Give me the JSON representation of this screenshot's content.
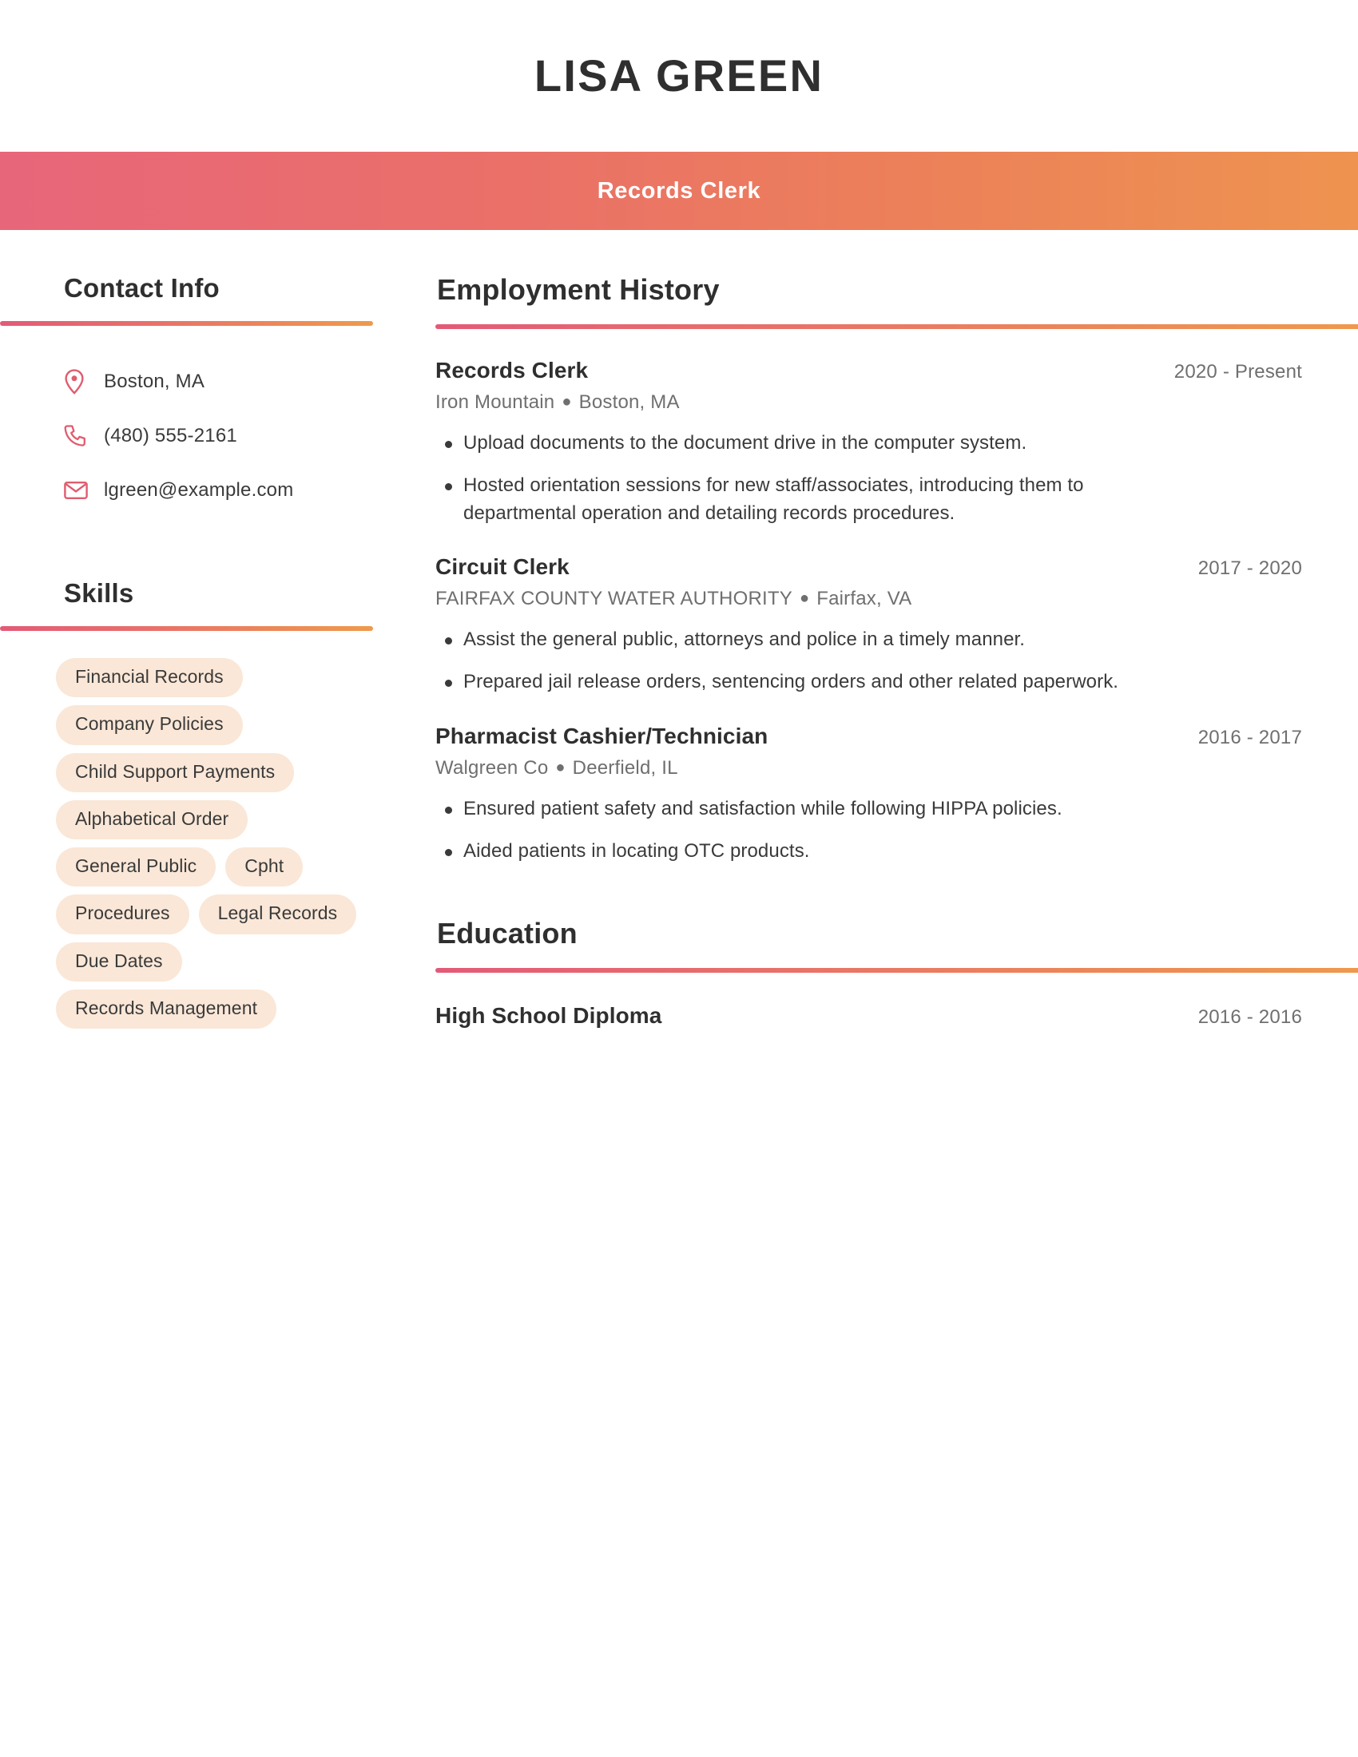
{
  "header": {
    "name": "LISA GREEN",
    "role": "Records Clerk",
    "gradient_start": "#e8667a",
    "gradient_end": "#ee9350"
  },
  "sidebar": {
    "contact": {
      "heading": "Contact Info",
      "items": [
        {
          "icon": "location-pin-icon",
          "value": "Boston, MA"
        },
        {
          "icon": "phone-icon",
          "value": "(480) 555-2161"
        },
        {
          "icon": "envelope-icon",
          "value": "lgreen@example.com"
        }
      ]
    },
    "skills": {
      "heading": "Skills",
      "chip_bg": "#fae7d7",
      "items": [
        "Financial Records",
        "Company Policies",
        "Child Support Payments",
        "Alphabetical Order",
        "General Public",
        "Cpht",
        "Procedures",
        "Legal Records",
        "Due Dates",
        "Records Management"
      ]
    }
  },
  "main": {
    "employment": {
      "heading": "Employment History",
      "jobs": [
        {
          "title": "Records Clerk",
          "dates": "2020 - Present",
          "company": "Iron Mountain",
          "location": "Boston, MA",
          "bullets": [
            "Upload documents to the document drive in the computer system.",
            "Hosted orientation sessions for new staff/associates, introducing them to departmental operation and detailing records procedures."
          ]
        },
        {
          "title": "Circuit Clerk",
          "dates": "2017 - 2020",
          "company": "FAIRFAX COUNTY WATER AUTHORITY",
          "location": "Fairfax, VA",
          "bullets": [
            "Assist the general public, attorneys and police in a timely manner.",
            "Prepared jail release orders, sentencing orders and other related paperwork."
          ]
        },
        {
          "title": "Pharmacist Cashier/Technician",
          "dates": "2016 - 2017",
          "company": "Walgreen Co",
          "location": "Deerfield, IL",
          "bullets": [
            "Ensured patient safety and satisfaction while following HIPPA policies.",
            "Aided patients in locating OTC products."
          ]
        }
      ]
    },
    "education": {
      "heading": "Education",
      "entries": [
        {
          "degree": "High School Diploma",
          "dates": "2016 - 2016"
        }
      ]
    }
  }
}
